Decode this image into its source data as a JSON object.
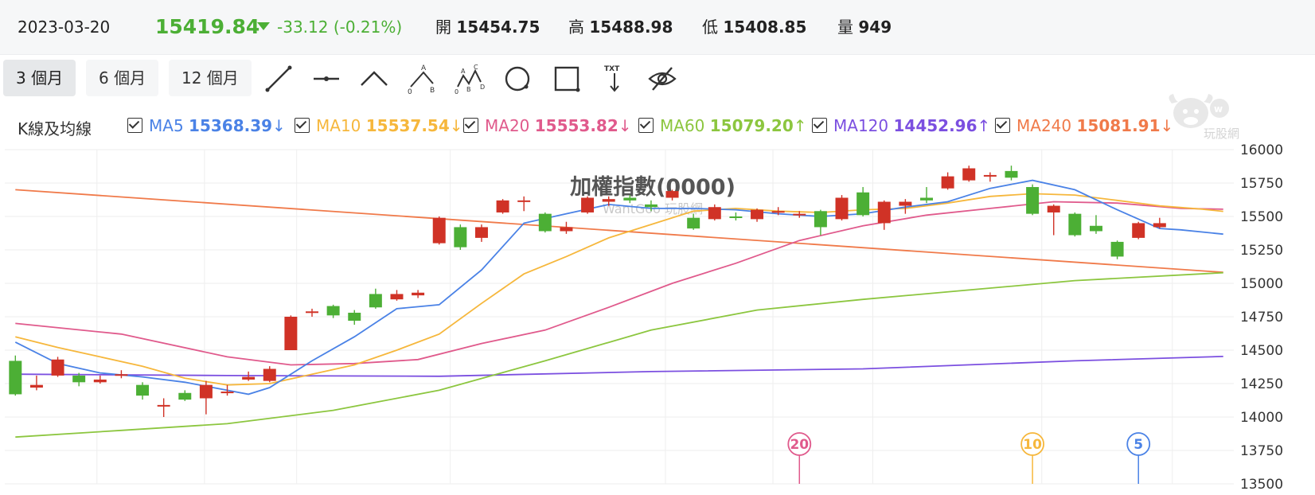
{
  "quote": {
    "date": "2023-03-20",
    "price": "15419.84",
    "change": "-33.12 (-0.21%)",
    "open_label": "開",
    "open": "15454.75",
    "high_label": "高",
    "high": "15488.98",
    "low_label": "低",
    "low": "15408.85",
    "volume_label": "量",
    "volume": "949",
    "down_color": "#4caf35",
    "up_color": "#d03226"
  },
  "toolbar": {
    "periods": [
      {
        "label": "3 個月",
        "active": true
      },
      {
        "label": "6 個月",
        "active": false
      },
      {
        "label": "12 個月",
        "active": false
      }
    ],
    "tools": [
      "line-tool-icon",
      "horizontal-line-icon",
      "angle-tool-icon",
      "abc-pattern-icon",
      "abcd-pattern-icon",
      "circle-tool-icon",
      "rectangle-tool-icon",
      "text-tool-icon",
      "hide-eye-icon"
    ],
    "tool_text": {
      "abc_a": "A",
      "abc_b": "B",
      "abc_0": "0",
      "abcd_a": "A",
      "abcd_b": "B",
      "abcd_c": "C",
      "abcd_d": "D",
      "abcd_0": "0",
      "txt": "TXT"
    }
  },
  "ma_legend": {
    "title": "K線及均線",
    "items": [
      {
        "name": "MA5",
        "value": "15368.39",
        "arrow": "↓",
        "color": "#4a82e6"
      },
      {
        "name": "MA10",
        "value": "15537.54",
        "arrow": "↓",
        "color": "#f6b73c"
      },
      {
        "name": "MA20",
        "value": "15553.82",
        "arrow": "↓",
        "color": "#e05a8c"
      },
      {
        "name": "MA60",
        "value": "15079.20",
        "arrow": "↑",
        "color": "#8cc63f"
      },
      {
        "name": "MA120",
        "value": "14452.96",
        "arrow": "↑",
        "color": "#7b4fe0"
      },
      {
        "name": "MA240",
        "value": "15081.91",
        "arrow": "↓",
        "color": "#f07a4a"
      }
    ]
  },
  "logo": {
    "text": "玩股網",
    "icon": "bull-logo-icon"
  },
  "chart_data": {
    "type": "candlestick",
    "title": "加權指數(0000)",
    "watermark": "WantGoo 玩股網",
    "ylim": [
      13500,
      16000
    ],
    "yticks": [
      "16000",
      "15750",
      "15500",
      "15250",
      "15000",
      "14750",
      "14500",
      "14250",
      "14000",
      "13750",
      "13500"
    ],
    "ytick_values": [
      16000,
      15750,
      15500,
      15250,
      15000,
      14750,
      14500,
      14250,
      14000,
      13750,
      13500
    ],
    "n": 58,
    "candles": [
      [
        14420,
        14170,
        14460,
        14160
      ],
      [
        14220,
        14240,
        14310,
        14200
      ],
      [
        14310,
        14430,
        14450,
        14300
      ],
      [
        14310,
        14260,
        14330,
        14230
      ],
      [
        14260,
        14280,
        14310,
        14250
      ],
      [
        14310,
        14320,
        14350,
        14290
      ],
      [
        14240,
        14160,
        14260,
        14130
      ],
      [
        14090,
        14090,
        14140,
        14000
      ],
      [
        14180,
        14130,
        14200,
        14120
      ],
      [
        14140,
        14240,
        14270,
        14020
      ],
      [
        14180,
        14190,
        14240,
        14160
      ],
      [
        14280,
        14300,
        14340,
        14270
      ],
      [
        14270,
        14360,
        14380,
        14260
      ],
      [
        14500,
        14750,
        14760,
        14500
      ],
      [
        14780,
        14790,
        14810,
        14750
      ],
      [
        14830,
        14760,
        14840,
        14740
      ],
      [
        14780,
        14720,
        14800,
        14690
      ],
      [
        14920,
        14820,
        14960,
        14810
      ],
      [
        14880,
        14920,
        14950,
        14870
      ],
      [
        14910,
        14930,
        14950,
        14890
      ],
      [
        15300,
        15490,
        15500,
        15290
      ],
      [
        15420,
        15270,
        15440,
        15250
      ],
      [
        15340,
        15420,
        15440,
        15310
      ],
      [
        15530,
        15620,
        15630,
        15520
      ],
      [
        15620,
        15620,
        15650,
        15540
      ],
      [
        15520,
        15390,
        15530,
        15380
      ],
      [
        15390,
        15420,
        15460,
        15370
      ],
      [
        15530,
        15640,
        15650,
        15520
      ],
      [
        15610,
        15630,
        15650,
        15580
      ],
      [
        15640,
        15620,
        15660,
        15600
      ],
      [
        15590,
        15570,
        15620,
        15540
      ],
      [
        15640,
        15690,
        15700,
        15620
      ],
      [
        15490,
        15410,
        15520,
        15400
      ],
      [
        15480,
        15570,
        15590,
        15470
      ],
      [
        15500,
        15490,
        15530,
        15470
      ],
      [
        15480,
        15550,
        15560,
        15460
      ],
      [
        15530,
        15540,
        15570,
        15510
      ],
      [
        15510,
        15520,
        15540,
        15490
      ],
      [
        15540,
        15420,
        15550,
        15360
      ],
      [
        15480,
        15640,
        15660,
        15470
      ],
      [
        15680,
        15510,
        15720,
        15500
      ],
      [
        15450,
        15610,
        15620,
        15400
      ],
      [
        15580,
        15610,
        15630,
        15520
      ],
      [
        15640,
        15620,
        15720,
        15600
      ],
      [
        15710,
        15800,
        15830,
        15700
      ],
      [
        15770,
        15860,
        15880,
        15760
      ],
      [
        15810,
        15810,
        15830,
        15760
      ],
      [
        15840,
        15790,
        15880,
        15770
      ],
      [
        15720,
        15520,
        15740,
        15510
      ],
      [
        15530,
        15580,
        15590,
        15360
      ],
      [
        15520,
        15360,
        15530,
        15350
      ],
      [
        15430,
        15390,
        15510,
        15370
      ],
      [
        15310,
        15200,
        15320,
        15180
      ],
      [
        15340,
        15450,
        15460,
        15330
      ],
      [
        15420,
        15450,
        15490,
        15410
      ]
    ],
    "ma_lines": {
      "MA240": {
        "color": "#f07a4a",
        "x": [
          0,
          57
        ],
        "y": [
          15700,
          15082
        ]
      },
      "MA120": {
        "color": "#7b4fe0",
        "x": [
          0,
          10,
          20,
          30,
          40,
          50,
          57
        ],
        "y": [
          14320,
          14310,
          14305,
          14340,
          14360,
          14420,
          14453
        ]
      },
      "MA60": {
        "color": "#8cc63f",
        "x": [
          0,
          5,
          10,
          15,
          20,
          25,
          30,
          35,
          40,
          45,
          50,
          57
        ],
        "y": [
          13850,
          13900,
          13950,
          14050,
          14200,
          14420,
          14650,
          14800,
          14880,
          14950,
          15020,
          15079
        ]
      },
      "MA20": {
        "color": "#e05a8c",
        "x": [
          0,
          5,
          10,
          13,
          16,
          19,
          22,
          25,
          28,
          31,
          34,
          37,
          40,
          43,
          46,
          49,
          52,
          55,
          57
        ],
        "y": [
          14700,
          14620,
          14450,
          14390,
          14400,
          14430,
          14550,
          14650,
          14820,
          15000,
          15150,
          15320,
          15430,
          15510,
          15560,
          15610,
          15600,
          15560,
          15554
        ]
      },
      "MA10": {
        "color": "#f6b73c",
        "x": [
          0,
          2,
          4,
          6,
          8,
          10,
          12,
          14,
          16,
          18,
          20,
          22,
          24,
          26,
          28,
          30,
          32,
          34,
          36,
          38,
          40,
          42,
          44,
          46,
          48,
          50,
          52,
          54,
          56,
          57
        ],
        "y": [
          14600,
          14520,
          14450,
          14380,
          14290,
          14240,
          14250,
          14320,
          14390,
          14500,
          14620,
          14850,
          15070,
          15200,
          15340,
          15440,
          15540,
          15560,
          15540,
          15530,
          15550,
          15560,
          15600,
          15650,
          15670,
          15660,
          15620,
          15580,
          15555,
          15538
        ]
      },
      "MA5": {
        "color": "#4a82e6",
        "x": [
          0,
          2,
          4,
          6,
          8,
          10,
          11,
          12,
          14,
          16,
          18,
          20,
          22,
          24,
          26,
          28,
          30,
          32,
          34,
          36,
          38,
          40,
          42,
          44,
          46,
          48,
          50,
          52,
          54,
          55,
          57
        ],
        "y": [
          14560,
          14400,
          14330,
          14300,
          14260,
          14200,
          14170,
          14220,
          14420,
          14600,
          14810,
          14840,
          15100,
          15450,
          15520,
          15590,
          15560,
          15560,
          15550,
          15520,
          15500,
          15520,
          15570,
          15610,
          15710,
          15770,
          15700,
          15550,
          15410,
          15400,
          15368
        ]
      }
    },
    "markers": [
      {
        "label": "20",
        "index": 37,
        "color": "#e05a8c"
      },
      {
        "label": "10",
        "index": 48,
        "color": "#f6b73c"
      },
      {
        "label": "5",
        "index": 53,
        "color": "#4a82e6"
      }
    ],
    "grid": true
  }
}
